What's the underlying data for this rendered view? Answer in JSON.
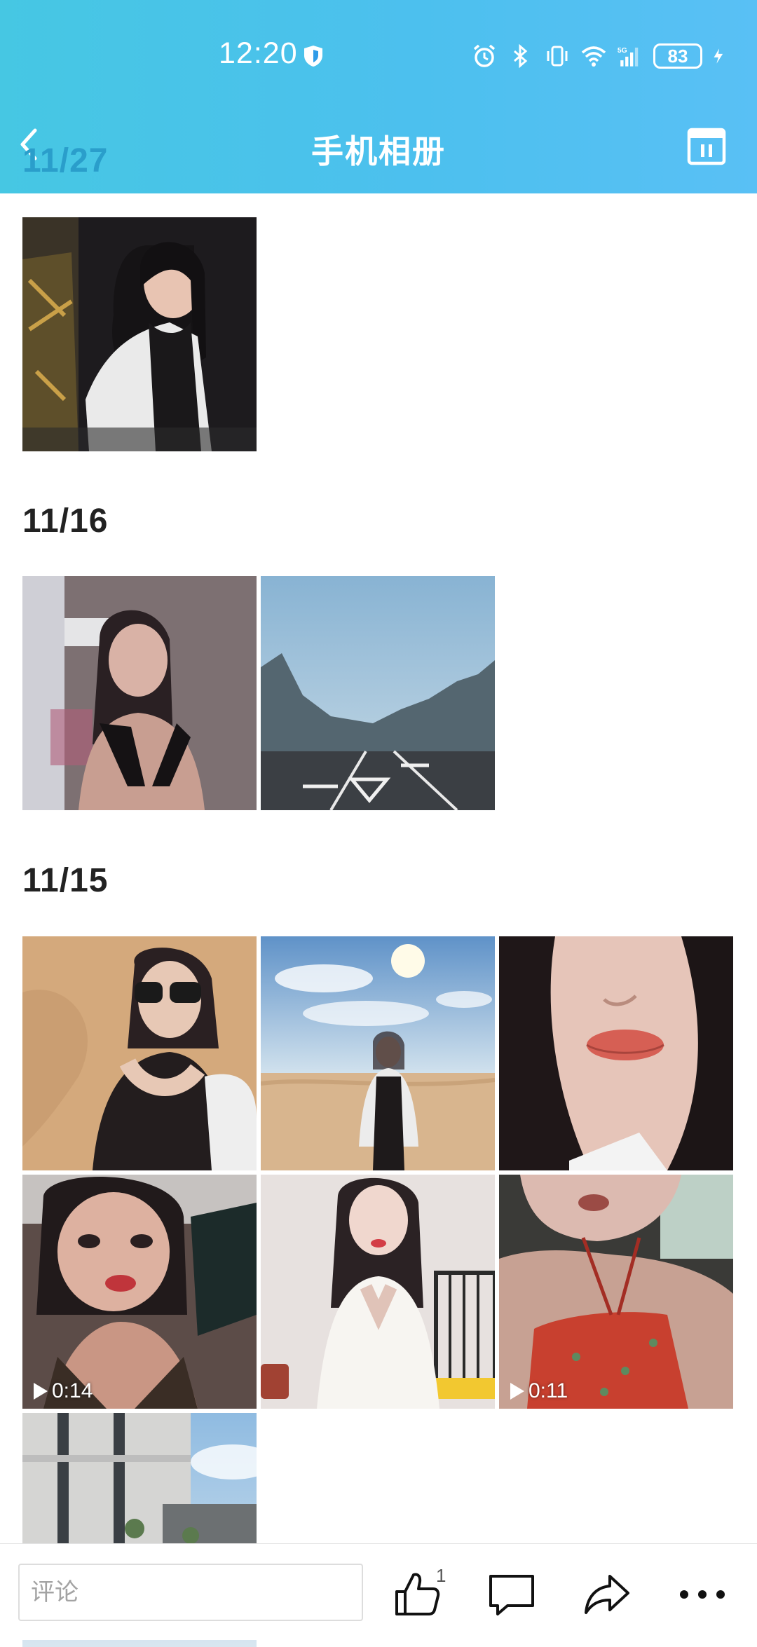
{
  "status_bar": {
    "time": "12:20",
    "battery": "83",
    "network": "5G"
  },
  "header": {
    "title": "手机相册",
    "date_peek": "11/27"
  },
  "sections": [
    {
      "date": "11/27",
      "photos": [
        {
          "scene": "portrait-car"
        }
      ]
    },
    {
      "date": "11/16",
      "photos": [
        {
          "scene": "portrait-room"
        },
        {
          "scene": "highway-mountains"
        }
      ]
    },
    {
      "date": "11/15",
      "photos": [
        {
          "scene": "desert-sunglasses"
        },
        {
          "scene": "desert-standing"
        },
        {
          "scene": "closeup-face"
        },
        {
          "scene": "selfie-bedroom",
          "duration": "0:14"
        },
        {
          "scene": "white-dress"
        },
        {
          "scene": "closeup-red-top",
          "duration": "0:11"
        },
        {
          "scene": "building-sky"
        }
      ]
    }
  ],
  "bottom_bar": {
    "comment_placeholder": "评论",
    "like_count": "1"
  },
  "colors": {
    "header_start": "#46c7e3",
    "header_end": "#59c0f5",
    "text_dark": "#222222"
  }
}
